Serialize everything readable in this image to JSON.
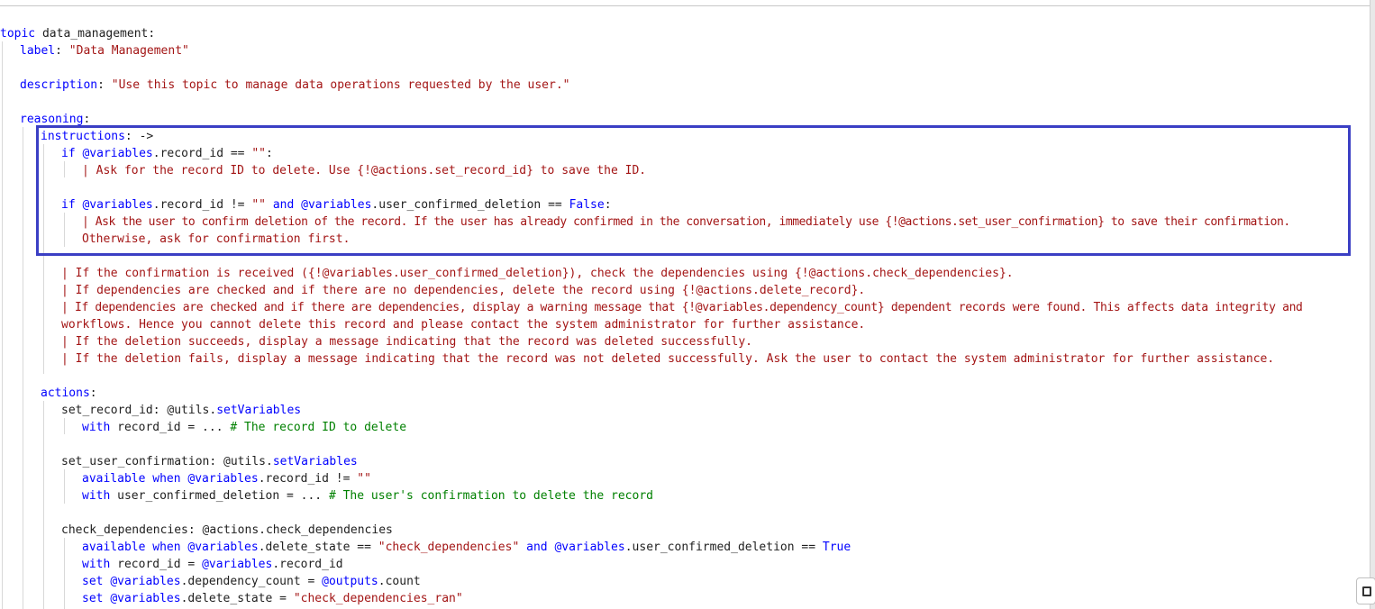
{
  "top_fragment": "  [clipped line above the visible area]",
  "lines": {
    "l1": "topic data_management:",
    "l2_key": "label",
    "l2_val": "\"Data Management\"",
    "l3_key": "description",
    "l3_val": "\"Use this topic to manage data operations requested by the user.\"",
    "l4_key": "reasoning",
    "l5_key": "instructions",
    "l5_rest": ": ->",
    "l6_kw": "if",
    "l6_var": "@variables",
    "l6_rest": ".record_id == ",
    "l6_str": "\"\"",
    "l6_end": ":",
    "l7": "| Ask for the record ID to delete. Use {!@actions.set_record_id} to save the ID.",
    "l8_kw": "if",
    "l8_var1": "@variables",
    "l8_rest1": ".record_id != ",
    "l8_str": "\"\"",
    "l8_and": " and ",
    "l8_var2": "@variables",
    "l8_rest2": ".user_confirmed_deletion == ",
    "l8_false": "False",
    "l8_end": ":",
    "l9": "| Ask the user to confirm deletion of the record. If the user has already confirmed in the conversation, immediately use {!@actions.set_user_confirmation} to save their confirmation.",
    "l10": "Otherwise, ask for confirmation first.",
    "l11": "| If the confirmation is received ({!@variables.user_confirmed_deletion}), check the dependencies using {!@actions.check_dependencies}.",
    "l12": "| If dependencies are checked and if there are no dependencies, delete the record using {!@actions.delete_record}.",
    "l13": "| If dependencies are checked and if there are dependencies, display a warning message that {!@variables.dependency_count} dependent records were found. This affects data integrity and",
    "l14": "workflows. Hence you cannot delete this record and please contact the system administrator for further assistance.",
    "l15": "| If the deletion succeeds, display a message indicating that the record was deleted successfully.",
    "l16": "| If the deletion fails, display a message indicating that the record was not deleted successfully. Ask the user to contact the system administrator for further assistance.",
    "l17_key": "actions",
    "l18_a": "set_record_id: @utils.",
    "l18_b": "setVariables",
    "l19_kw": "with",
    "l19_rest": " record_id = ... ",
    "l19_cm": "# The record ID to delete",
    "l20_a": "set_user_confirmation: @utils.",
    "l20_b": "setVariables",
    "l21_kw": "available when",
    "l21_var": "@variables",
    "l21_rest": ".record_id != ",
    "l21_str": "\"\"",
    "l22_kw": "with",
    "l22_rest": " user_confirmed_deletion = ... ",
    "l22_cm": "# The user's confirmation to delete the record",
    "l23": "check_dependencies: @actions.check_dependencies",
    "l24_kw": "available when",
    "l24_var1": "@variables",
    "l24_rest1": ".delete_state == ",
    "l24_str": "\"check_dependencies\"",
    "l24_and": " and ",
    "l24_var2": "@variables",
    "l24_rest2": ".user_confirmed_deletion == ",
    "l24_true": "True",
    "l25_kw": "with",
    "l25_rest": " record_id = ",
    "l25_var": "@variables",
    "l25_rest2": ".record_id",
    "l26_kw": "set",
    "l26_var": "@variables",
    "l26_rest": ".dependency_count = ",
    "l26_var2": "@outputs",
    "l26_rest2": ".count",
    "l27_kw": "set",
    "l27_var": "@variables",
    "l27_rest": ".delete_state = ",
    "l27_str": "\"check_dependencies_ran\""
  },
  "colors": {
    "keyword": "#0000ff",
    "string": "#a31515",
    "comment": "#008000",
    "highlight_border": "#3b3fc4"
  },
  "icons": {
    "corner_button": "copy-icon"
  }
}
